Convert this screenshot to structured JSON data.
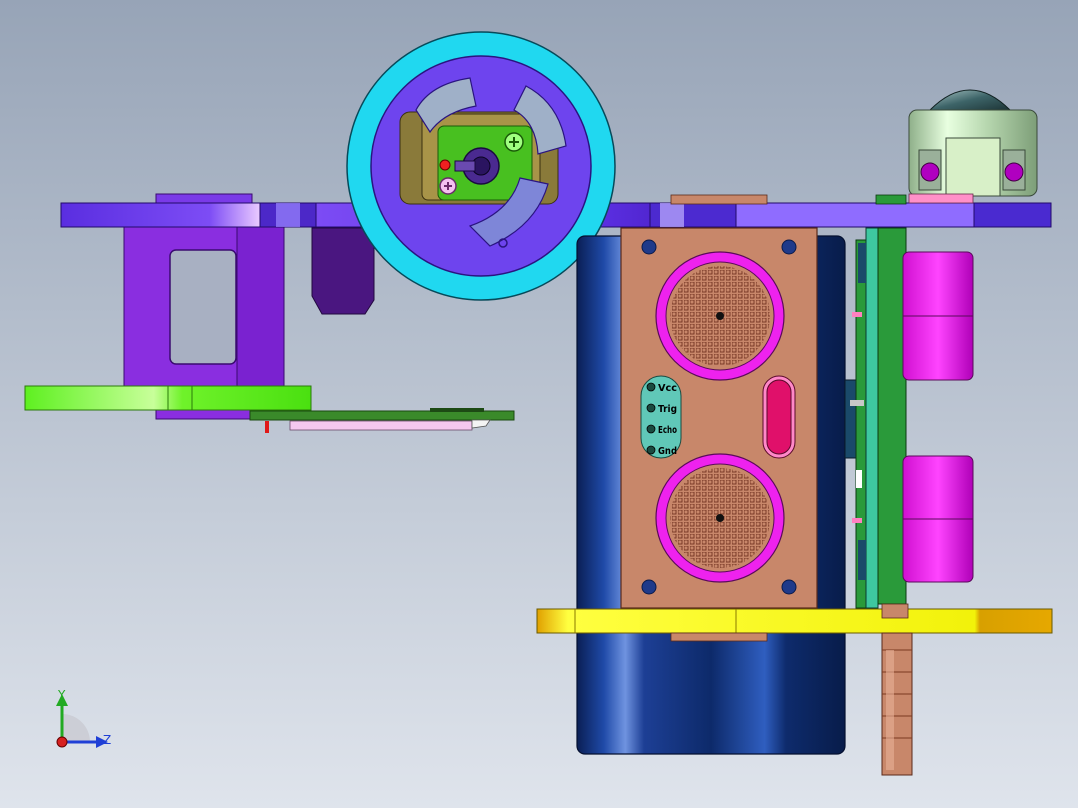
{
  "model_view": {
    "name": "cad-assembly-side-view",
    "background": {
      "top": "#9aa6b8",
      "bottom": "#dde2ea"
    }
  },
  "sensor": {
    "name": "ultrasonic-sensor-module",
    "pins": [
      "Vcc",
      "Trig",
      "Echo",
      "Gnd"
    ]
  },
  "axes": {
    "y_label": "Y",
    "z_label": "Z",
    "y_color": "#22aa22",
    "z_color": "#1f3fd6",
    "x_color": "#d62020"
  },
  "colors": {
    "chassis_plate": "#6a3cf0",
    "wheel_rim": "#20d8f0",
    "wheel_hub": "#6e44ee",
    "bracket": "#8a2ee0",
    "bottom_plate": "#f2f20a",
    "sensor_board": "#c8876a",
    "transducer_ring": "#ee22ee",
    "battery": "#0d2a6a",
    "pcb": "#2a9a3a",
    "caster": "#c8e8b8"
  }
}
